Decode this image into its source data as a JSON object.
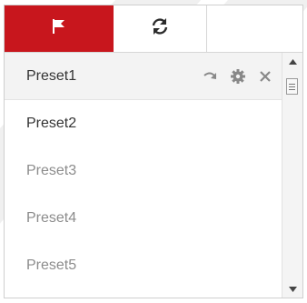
{
  "tabs": [
    {
      "icon": "flag-icon",
      "active": true
    },
    {
      "icon": "refresh-icon",
      "active": false
    }
  ],
  "presets": [
    {
      "label": "Preset1",
      "selected": true,
      "set": true
    },
    {
      "label": "Preset2",
      "selected": false,
      "set": true
    },
    {
      "label": "Preset3",
      "selected": false,
      "set": false
    },
    {
      "label": "Preset4",
      "selected": false,
      "set": false
    },
    {
      "label": "Preset5",
      "selected": false,
      "set": false
    }
  ],
  "row_actions": [
    "call-preset-icon",
    "settings-gear-icon",
    "close-icon"
  ],
  "colors": {
    "active_tab": "#c8161d",
    "selected_row": "#f3f3f3",
    "text_set": "#333333",
    "text_unset": "#8c8c8c"
  }
}
